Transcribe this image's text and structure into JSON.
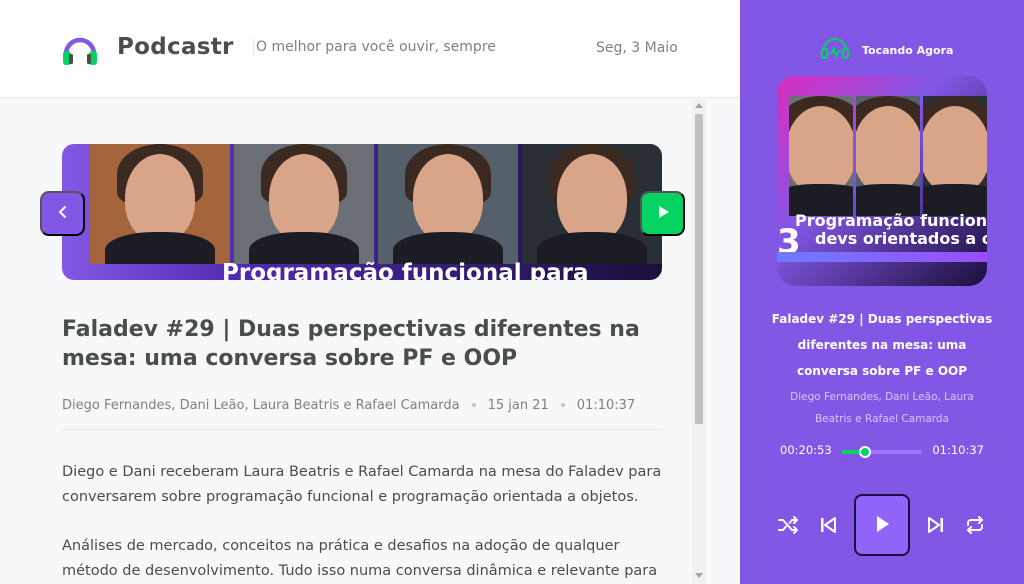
{
  "header": {
    "brand": "Podcastr",
    "tagline": "O melhor para você ouvir, sempre",
    "date": "Seg, 3 Maio"
  },
  "episode": {
    "thumbnail_text": "Programação funcional para",
    "title": "Faladev #29 | Duas perspectivas diferentes na mesa: uma conversa sobre PF e OOP",
    "members": "Diego Fernandes, Dani Leão, Laura Beatris e Rafael Camarda",
    "published_at": "15 jan 21",
    "duration": "01:10:37",
    "description": [
      "Diego e Dani receberam Laura Beatris e Rafael Camarda na mesa do Faladev para conversarem sobre programação funcional e programação orientada a objetos.",
      "Análises de mercado, conceitos na prática e desafios na adoção de qualquer método de desenvolvimento. Tudo isso numa conversa dinâmica e relevante para"
    ]
  },
  "player": {
    "label": "Tocando Agora",
    "cover_number": "3",
    "cover_text_line1": "Programação funcional",
    "cover_text_line2": "devs orientados a o",
    "title": "Faladev #29 | Duas perspectivas diferentes na mesa: uma conversa sobre PF e OOP",
    "members": "Diego Fernandes, Dani Leão, Laura Beatris e Rafael Camarda",
    "current_time": "00:20:53",
    "duration": "01:10:37",
    "progress_fraction": 0.29
  },
  "icons": {
    "logo": "headphones-icon",
    "playing": "headphones-wave-icon",
    "nav_prev": "chevron-left-icon",
    "nav_next": "play-icon",
    "shuffle": "shuffle-icon",
    "previous": "skip-previous-icon",
    "play": "play-icon",
    "next": "skip-next-icon",
    "repeat": "repeat-icon"
  },
  "colors": {
    "purple": "#8257e5",
    "green": "#04d361",
    "text_dark": "#494d4b",
    "text_muted": "#808080"
  }
}
